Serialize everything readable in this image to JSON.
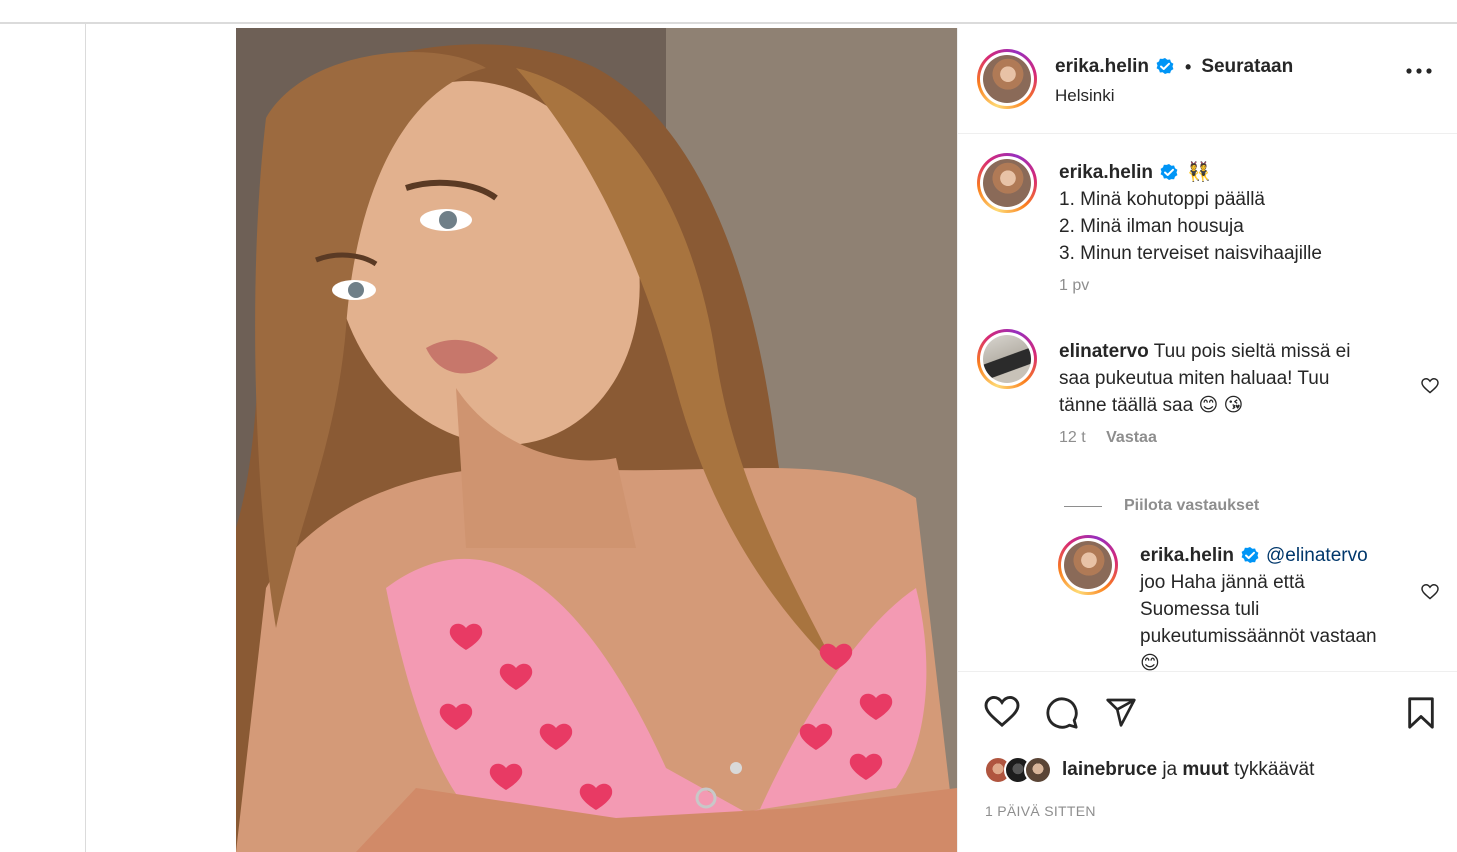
{
  "post": {
    "author": "erika.helin",
    "follow_state": "Seurataan",
    "separator": "•",
    "location": "Helsinki",
    "image_alt": "Selfie of a woman with long light-brown hair wearing a pink bikini top with red heart pattern"
  },
  "caption": {
    "author": "erika.helin",
    "emoji": "👯",
    "lines": [
      "1. Minä kohutoppi päällä",
      "2. Minä ilman housuja",
      "3. Minun terveiset naisvihaajille"
    ],
    "age": "1 pv"
  },
  "comments": [
    {
      "author": "elinatervo",
      "text_line1": "Tuu pois sieltä missä ei",
      "text_line2": "saa pukeutua miten haluaa! Tuu",
      "text_line3": "tänne täällä saa 😊 😘",
      "age": "12 t",
      "reply_label": "Vastaa",
      "hide_replies_label": "Piilota vastaukset",
      "replies": [
        {
          "author": "erika.helin",
          "mention": "@elinatervo",
          "text_line1": "joo Haha jännä että",
          "text_line2": "Suomessa tuli",
          "text_line3": "pukeutumissäännöt vastaan",
          "text_line4": "😊"
        }
      ]
    }
  ],
  "likes": {
    "first_liker": "lainebruce",
    "conjunction": "ja",
    "others": "muut",
    "verb": "tykkäävät"
  },
  "timestamp": "1 PÄIVÄ SITTEN",
  "colors": {
    "text": "#262626",
    "muted": "#8e8e8e",
    "verified": "#0095f6",
    "border": "#dbdbdb"
  },
  "icons": [
    "more-icon",
    "verified-icon",
    "heart-icon",
    "comment-icon",
    "share-icon",
    "bookmark-icon",
    "chevron-right-icon"
  ]
}
